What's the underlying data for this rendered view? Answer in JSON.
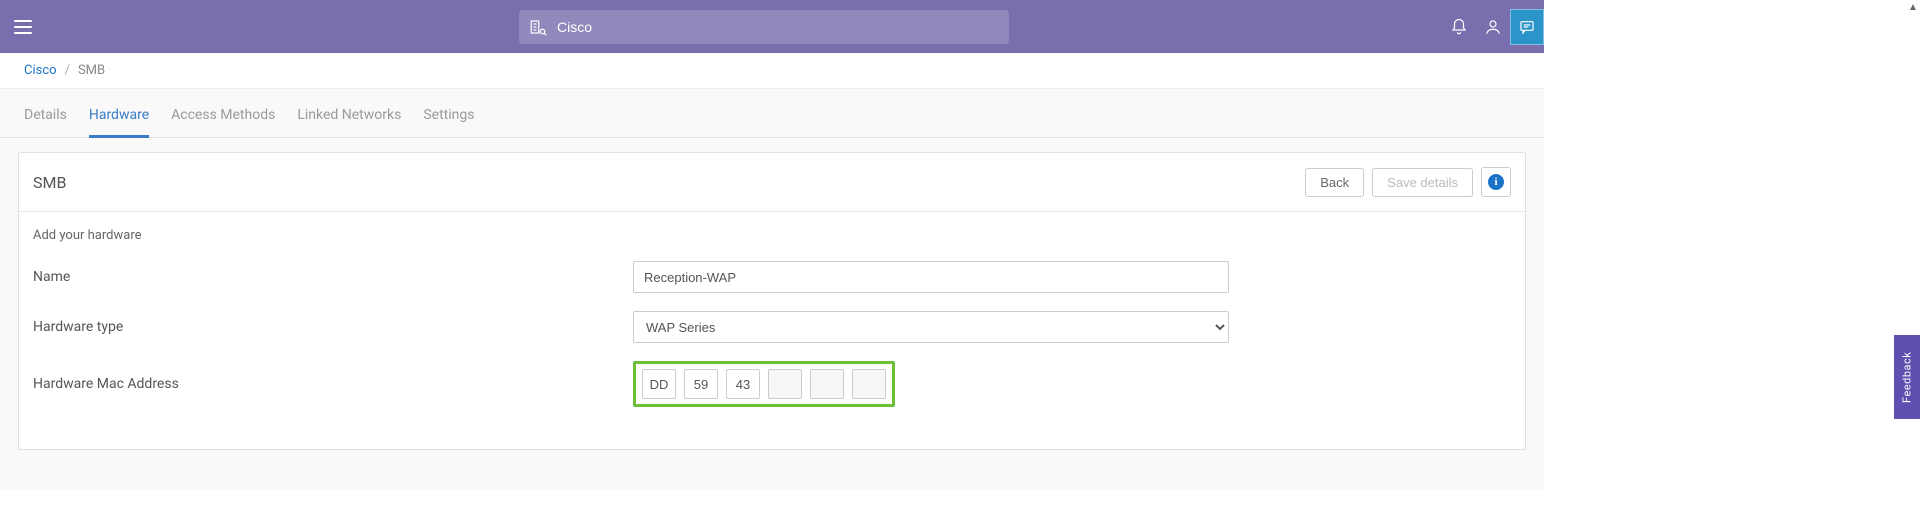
{
  "header": {
    "search_value": "Cisco"
  },
  "breadcrumb": {
    "root": "Cisco",
    "sep": "/",
    "current": "SMB"
  },
  "tabs": {
    "details": "Details",
    "hardware": "Hardware",
    "access": "Access Methods",
    "linked": "Linked Networks",
    "settings": "Settings"
  },
  "panel": {
    "title": "SMB",
    "back": "Back",
    "save": "Save details",
    "info_glyph": "i",
    "subtitle": "Add your hardware",
    "name_label": "Name",
    "name_value": "Reception-WAP",
    "type_label": "Hardware type",
    "type_value": "WAP Series",
    "mac_label": "Hardware Mac Address",
    "mac": {
      "o1": "DD",
      "o2": "59",
      "o3": "43",
      "o4": "",
      "o5": "",
      "o6": ""
    }
  },
  "feedback": "Feedback"
}
